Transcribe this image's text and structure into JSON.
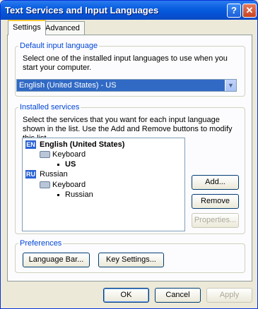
{
  "window": {
    "title": "Text Services and Input Languages",
    "help_glyph": "?",
    "close_glyph": "✕"
  },
  "tabs": [
    {
      "label": "Settings",
      "active": true
    },
    {
      "label": "Advanced",
      "active": false
    }
  ],
  "default_language": {
    "legend": "Default input language",
    "description": "Select one of the installed input languages to use when you start your computer.",
    "selected": "English (United States) - US"
  },
  "installed_services": {
    "legend": "Installed services",
    "description": "Select the services that you want for each input language shown in the list. Use the Add and Remove buttons to modify this list.",
    "languages": [
      {
        "badge": "EN",
        "name": "English (United States)",
        "category": "Keyboard",
        "service": "US"
      },
      {
        "badge": "RU",
        "name": "Russian",
        "category": "Keyboard",
        "service": "Russian"
      }
    ],
    "buttons": {
      "add": "Add...",
      "remove": "Remove",
      "properties": "Properties..."
    }
  },
  "preferences": {
    "legend": "Preferences",
    "language_bar": "Language Bar...",
    "key_settings": "Key Settings..."
  },
  "footer": {
    "ok": "OK",
    "cancel": "Cancel",
    "apply": "Apply"
  }
}
